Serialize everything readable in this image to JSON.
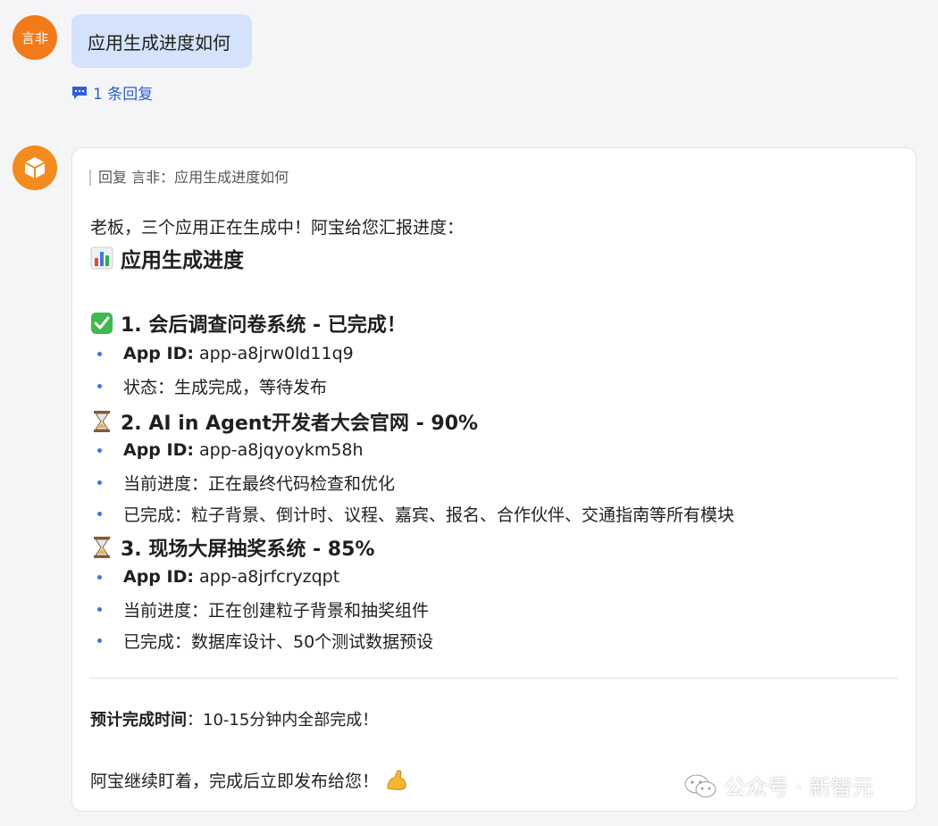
{
  "user_message": {
    "avatar_text": "言非",
    "text": "应用生成进度如何",
    "reply_count_label": "1 条回复"
  },
  "bot_message": {
    "quote": "回复 言非：应用生成进度如何",
    "intro": "老板，三个应用正在生成中！阿宝给您汇报进度：",
    "section_title": "应用生成进度",
    "apps": [
      {
        "title": "1. 会后调查问卷系统 - 已完成！",
        "status_icon": "check-icon",
        "app_id_label": "App ID:",
        "app_id": "app-a8jrw0ld11q9",
        "details": [
          "状态：生成完成，等待发布"
        ]
      },
      {
        "title": "2. AI in Agent开发者大会官网 - 90%",
        "status_icon": "hourglass-icon",
        "progress_percent": 90,
        "app_id_label": "App ID:",
        "app_id": "app-a8jqyoykm58h",
        "details": [
          "当前进度：正在最终代码检查和优化",
          "已完成：粒子背景、倒计时、议程、嘉宾、报名、合作伙伴、交通指南等所有模块"
        ]
      },
      {
        "title": "3. 现场大屏抽奖系统 - 85%",
        "status_icon": "hourglass-icon",
        "progress_percent": 85,
        "app_id_label": "App ID:",
        "app_id": "app-a8jrfcryzqpt",
        "details": [
          "当前进度：正在创建粒子背景和抽奖组件",
          "已完成：数据库设计、50个测试数据预设"
        ]
      }
    ],
    "eta_label": "预计完成时间",
    "eta_value": "：10-15分钟内全部完成！",
    "outro": "阿宝继续盯着，完成后立即发布给您！"
  },
  "watermark": {
    "text": "公众号 · 新智元"
  },
  "colors": {
    "user_bubble": "#d4e2fb",
    "link": "#2f5fd8",
    "avatar_orange": "#f27a1a",
    "bullet": "#4a6fd4",
    "check_green": "#3fb950"
  }
}
